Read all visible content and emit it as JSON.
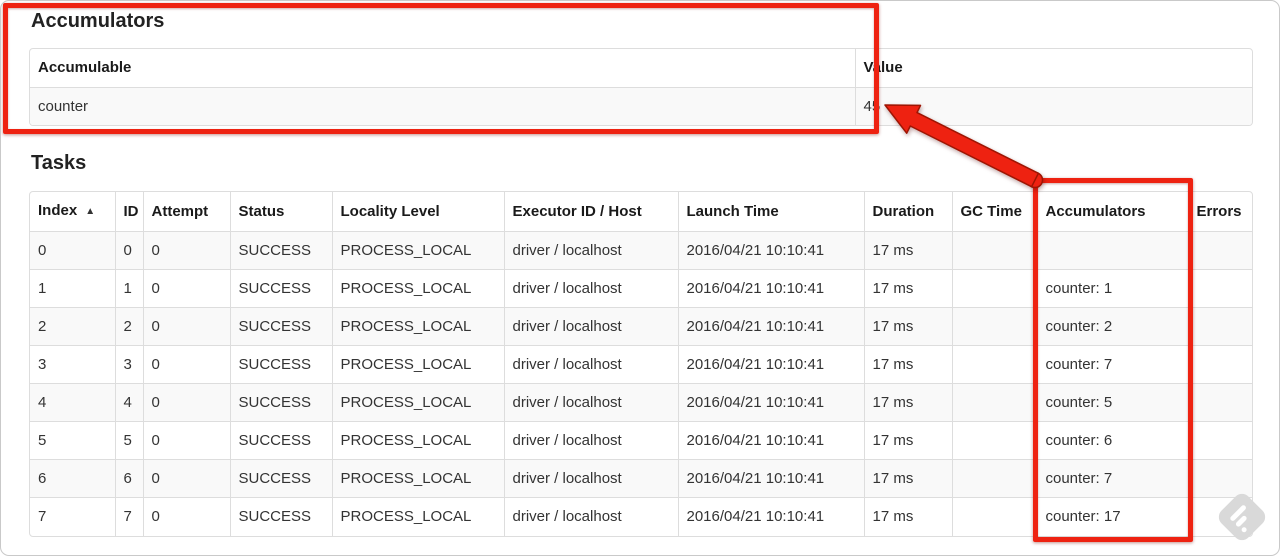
{
  "accumulators_section": {
    "title": "Accumulators",
    "table": {
      "headers": [
        "Accumulable",
        "Value"
      ],
      "rows": [
        [
          "counter",
          "45"
        ]
      ]
    }
  },
  "tasks_section": {
    "title": "Tasks",
    "sort_indicator": "▲",
    "table": {
      "headers": [
        "Index",
        "ID",
        "Attempt",
        "Status",
        "Locality Level",
        "Executor ID / Host",
        "Launch Time",
        "Duration",
        "GC Time",
        "Accumulators",
        "Errors"
      ],
      "rows": [
        [
          "0",
          "0",
          "0",
          "SUCCESS",
          "PROCESS_LOCAL",
          "driver / localhost",
          "2016/04/21 10:10:41",
          "17 ms",
          "",
          "",
          ""
        ],
        [
          "1",
          "1",
          "0",
          "SUCCESS",
          "PROCESS_LOCAL",
          "driver / localhost",
          "2016/04/21 10:10:41",
          "17 ms",
          "",
          "counter: 1",
          ""
        ],
        [
          "2",
          "2",
          "0",
          "SUCCESS",
          "PROCESS_LOCAL",
          "driver / localhost",
          "2016/04/21 10:10:41",
          "17 ms",
          "",
          "counter: 2",
          ""
        ],
        [
          "3",
          "3",
          "0",
          "SUCCESS",
          "PROCESS_LOCAL",
          "driver / localhost",
          "2016/04/21 10:10:41",
          "17 ms",
          "",
          "counter: 7",
          ""
        ],
        [
          "4",
          "4",
          "0",
          "SUCCESS",
          "PROCESS_LOCAL",
          "driver / localhost",
          "2016/04/21 10:10:41",
          "17 ms",
          "",
          "counter: 5",
          ""
        ],
        [
          "5",
          "5",
          "0",
          "SUCCESS",
          "PROCESS_LOCAL",
          "driver / localhost",
          "2016/04/21 10:10:41",
          "17 ms",
          "",
          "counter: 6",
          ""
        ],
        [
          "6",
          "6",
          "0",
          "SUCCESS",
          "PROCESS_LOCAL",
          "driver / localhost",
          "2016/04/21 10:10:41",
          "17 ms",
          "",
          "counter: 7",
          ""
        ],
        [
          "7",
          "7",
          "0",
          "SUCCESS",
          "PROCESS_LOCAL",
          "driver / localhost",
          "2016/04/21 10:10:41",
          "17 ms",
          "",
          "counter: 17",
          ""
        ]
      ]
    }
  },
  "annotations": {
    "color": "#ee2211",
    "box_count": "2",
    "arrow_points_to": "45"
  }
}
